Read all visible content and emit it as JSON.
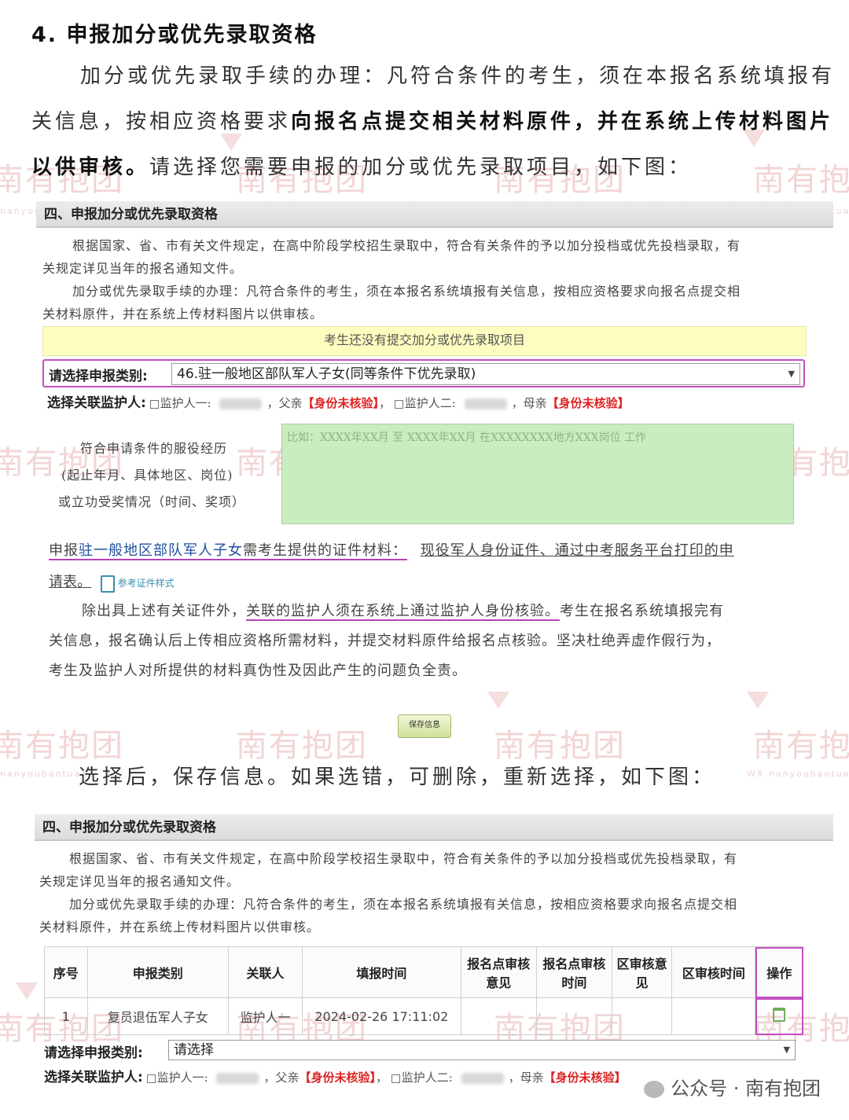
{
  "heading": "4. 申报加分或优先录取资格",
  "intro": {
    "line1": "加分或优先录取手续的办理：凡符合条件的考生，须在本报名系统填报有",
    "line2_normal": "关信息，按相应资格要求",
    "line2_bold": "向报名点提交相关材料原件，并在系统上传材料图片",
    "line3_bold": "以供审核。",
    "line3_normal": "请选择您需要申报的加分或优先录取项目，如下图："
  },
  "panel1": {
    "header": "四、申报加分或优先录取资格",
    "p1a": "根据国家、省、市有关文件规定，在高中阶段学校招生录取中，符合有关条件的予以加分投档或优先投档录取，有",
    "p1b": "关规定详见当年的报名通知文件。",
    "p2a": "加分或优先录取手续的办理：凡符合条件的考生，须在本报名系统填报有关信息，按相应资格要求向报名点提交相",
    "p2b": "关材料原件，并在系统上传材料图片以供审核。",
    "notice": "考生还没有提交加分或优先录取项目",
    "category_label": "请选择申报类别:",
    "category_value": "46.驻一般地区部队军人子女(同等条件下优先录取)",
    "guardian_label": "选择关联监护人:",
    "guardian1": "监护人一:",
    "relation1": "父亲",
    "status1": "【身份未核验】",
    "guardian2": "监护人二:",
    "relation2": "母亲",
    "status2": "【身份未核验】",
    "service_label1": "符合申请条件的服役经历",
    "service_label2": "(起止年月、具体地区、岗位)",
    "service_label3": "或立功受奖情况（时间、奖项）",
    "service_placeholder": "比如：XXXX年XX月 至 XXXX年XX月 在XXXXXXXX地方XXX岗位 工作",
    "req_prefix": "申报",
    "req_category": "驻一般地区部队军人子女",
    "req_mid": "需考生提供的证件材料：",
    "req_docs": "现役军人身份证件、通过中考服务平台打印的申",
    "req_docs2": "请表。",
    "ref_link": "参考证件样式",
    "note_a": "除出具上述有关证件外，",
    "note_b": "关联的监护人须在系统上通过监护人身份核验。",
    "note_c": "考生在报名系统填报完有",
    "note_line2": "关信息，报名确认后上传相应资格所需材料，并提交材料原件给报名点核验。坚决杜绝弄虚作假行为，",
    "note_line3": "考生及监护人对所提供的材料真伪性及因此产生的问题负全责。",
    "save_button": "保存信息"
  },
  "mid_text": "选择后，保存信息。如果选错，可删除，重新选择，如下图：",
  "panel2": {
    "header": "四、申报加分或优先录取资格",
    "p1a": "根据国家、省、市有关文件规定，在高中阶段学校招生录取中，符合有关条件的予以加分投档或优先投档录取，有",
    "p1b": "关规定详见当年的报名通知文件。",
    "p2a": "加分或优先录取手续的办理：凡符合条件的考生，须在本报名系统填报有关信息，按相应资格要求向报名点提交相",
    "p2b": "关材料原件，并在系统上传材料图片以供审核。",
    "columns": [
      "序号",
      "申报类别",
      "关联人",
      "填报时间",
      "报名点审核意见",
      "报名点审核时间",
      "区审核意见",
      "区审核时间",
      "操作"
    ],
    "rows": [
      {
        "no": "1",
        "category": "复员退伍军人子女",
        "guardian": "监护人一",
        "time": "2024-02-26 17:11:02",
        "site_opinion": "",
        "site_time": "",
        "district_opinion": "",
        "district_time": ""
      }
    ],
    "category_label": "请选择申报类别:",
    "category_value": "请选择",
    "guardian_label": "选择关联监护人:",
    "guardian1": "监护人一:",
    "relation1": "父亲",
    "status1": "【身份未核验】",
    "guardian2": "监护人二:",
    "relation2": "母亲",
    "status2": "【身份未核验】"
  },
  "watermark": {
    "text": "南有抱团",
    "small": "nanyoubaotuan",
    "small_wx": "WX nanyoubaotuan"
  },
  "footer": {
    "account": "公众号 · 南有抱团"
  },
  "colors": {
    "accent_purple": "#c24fc2",
    "notice_yellow": "#fefdc0",
    "textarea_green": "#c9ecc0",
    "status_red": "#d22222"
  }
}
